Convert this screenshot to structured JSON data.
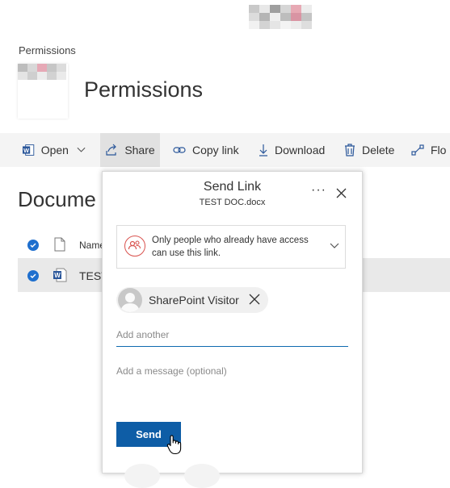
{
  "breadcrumb": "Permissions",
  "page_title": "Permissions",
  "command_bar": {
    "open": "Open",
    "share": "Share",
    "copy_link": "Copy link",
    "download": "Download",
    "delete": "Delete",
    "flow": "Flo"
  },
  "library": {
    "heading": "Docume",
    "name_header": "Name",
    "file_name": "TEST"
  },
  "dialog": {
    "title": "Send Link",
    "filename": "TEST  DOC.docx",
    "more": "···",
    "permission_text": "Only people who already have access can use this link.",
    "recipient": "SharePoint Visitor",
    "add_placeholder": "Add another",
    "message_placeholder": "Add a message (optional)",
    "send_label": "Send"
  },
  "colors": {
    "accent": "#0e5da6",
    "check": "#1f6fce",
    "permission_icon": "#d9534f",
    "word": "#2b579a"
  }
}
